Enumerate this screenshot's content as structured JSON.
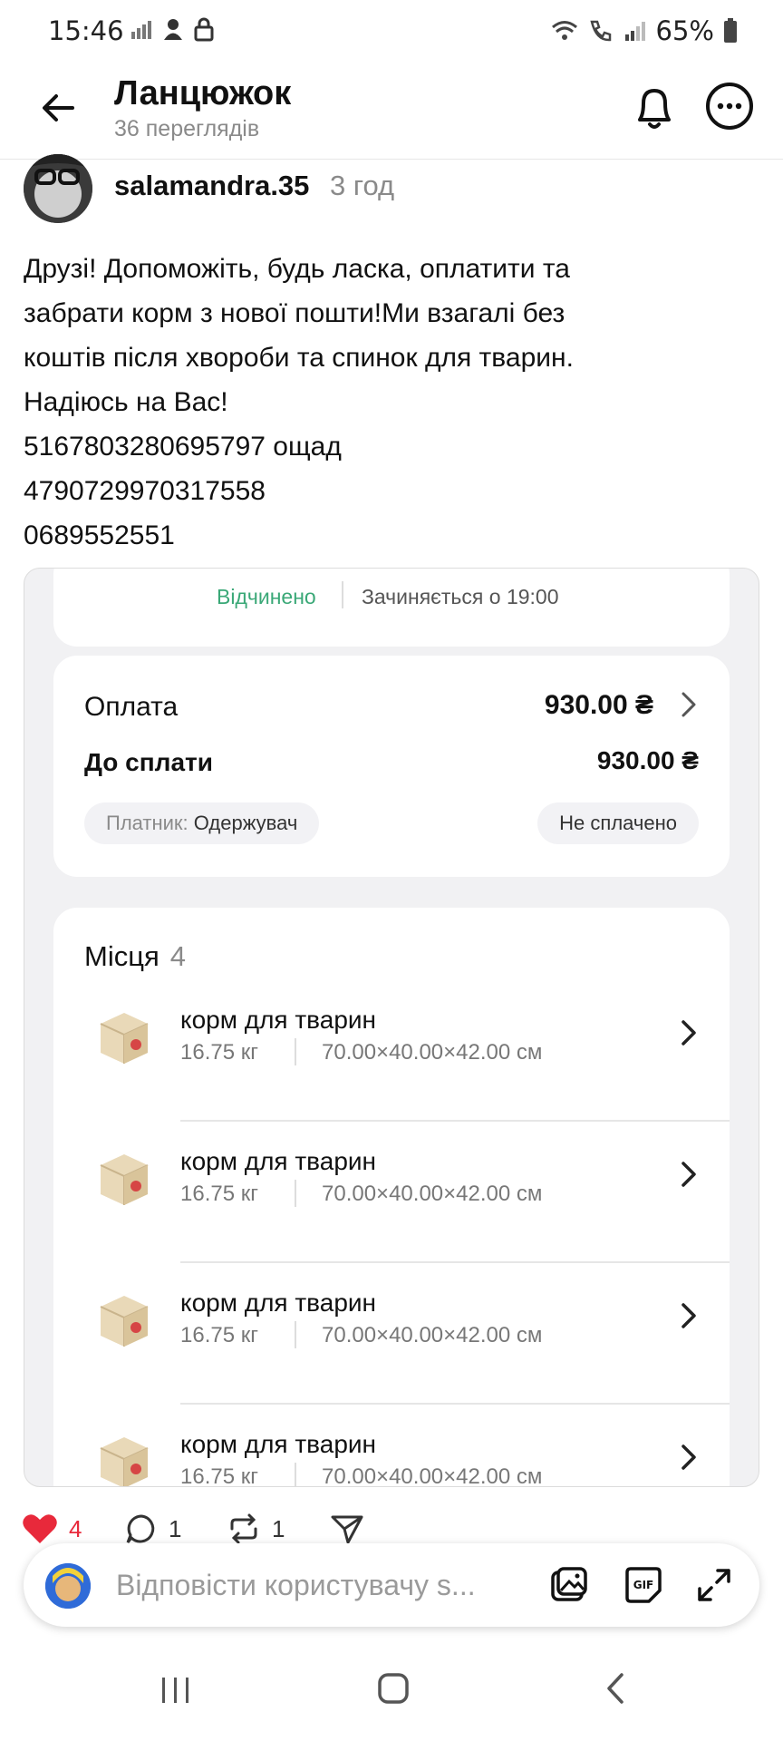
{
  "status_bar": {
    "time": "15:46",
    "battery": "65%"
  },
  "header": {
    "title": "Ланцюжок",
    "subtitle": "36 переглядів"
  },
  "post": {
    "username": "salamandra.35",
    "time_ago": "3 год",
    "text_lines": [
      "Друзі! Допоможіть, будь ласка, оплатити та",
      "забрати корм з нової пошти!Ми взагалі без",
      "коштів після хвороби та спинок для тварин.",
      "Надіюсь на Вас!",
      "5167803280695797 ощад",
      "4790729970317558",
      "0689552551"
    ]
  },
  "screenshot": {
    "status_open": "Відчинено",
    "closes_at": "Зачиняється о 19:00",
    "payment_label": "Оплата",
    "payment_amount": "930.00 ₴",
    "due_label": "До сплати",
    "due_amount": "930.00 ₴",
    "payer_label": "Платник:",
    "payer_value": "Одержувач",
    "unpaid": "Не сплачено",
    "places_label": "Місця",
    "places_count": "4",
    "items": [
      {
        "name": "корм для тварин",
        "weight": "16.75 кг",
        "dims": "70.00×40.00×42.00 см"
      },
      {
        "name": "корм для тварин",
        "weight": "16.75 кг",
        "dims": "70.00×40.00×42.00 см"
      },
      {
        "name": "корм для тварин",
        "weight": "16.75 кг",
        "dims": "70.00×40.00×42.00 см"
      },
      {
        "name": "корм для тварин",
        "weight": "16.75 кг",
        "dims": "70.00×40.00×42.00 см"
      }
    ]
  },
  "actions": {
    "likes": "4",
    "comments": "1",
    "reposts": "1"
  },
  "reply": {
    "placeholder": "Відповісти користувачу s..."
  },
  "colors": {
    "like": "#e8293b",
    "open_status": "#3aa877"
  },
  "icons": [
    "back-arrow-icon",
    "bell-icon",
    "more-icon",
    "heart-icon",
    "comment-icon",
    "repost-icon",
    "share-icon",
    "image-icon",
    "gif-icon",
    "expand-icon"
  ]
}
